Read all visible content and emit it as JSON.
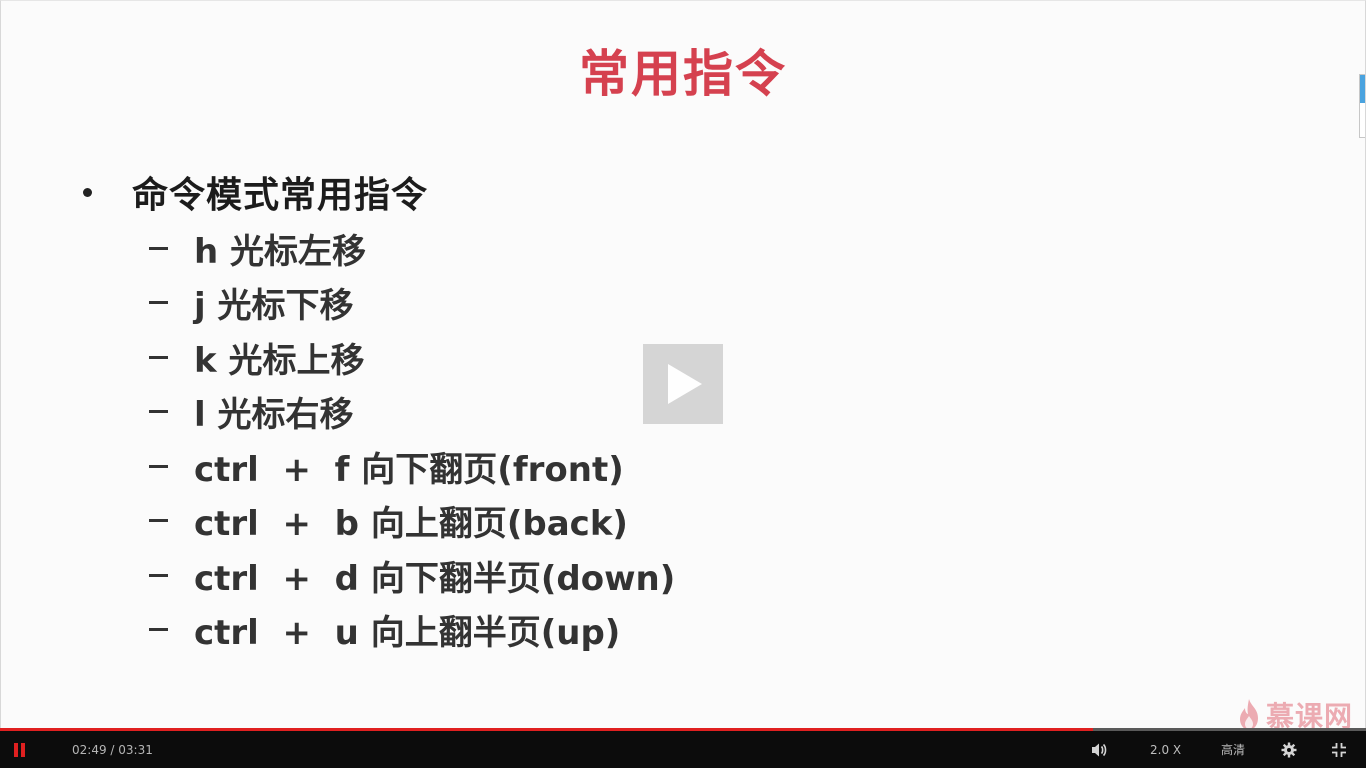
{
  "slide": {
    "title": "常用指令",
    "bullet": "命令模式常用指令",
    "sub_items": [
      "h 光标左移",
      "j 光标下移",
      "k 光标上移",
      "l 光标右移",
      "ctrl  +  f 向下翻页(front)",
      "ctrl  +  b 向上翻页(back)",
      "ctrl  +  d 向下翻半页(down)",
      "ctrl  +  u 向上翻半页(up)"
    ],
    "watermark": "慕课网"
  },
  "player": {
    "current_time": "02:49",
    "duration": "03:31",
    "time_display": "02:49 / 03:31",
    "progress_fraction": 0.8,
    "speed": "2.0 X",
    "quality": "高清"
  },
  "icons": {
    "play": "play-icon",
    "pause": "pause-icon",
    "volume": "volume-icon",
    "settings": "gear-icon",
    "fullscreen": "exit-fullscreen-icon",
    "watermark": "flame-logo-icon"
  },
  "colors": {
    "title": "#d5414f",
    "progress": "#e02020",
    "control_bar": "#0c0c0c",
    "watermark": "#e06b78"
  }
}
